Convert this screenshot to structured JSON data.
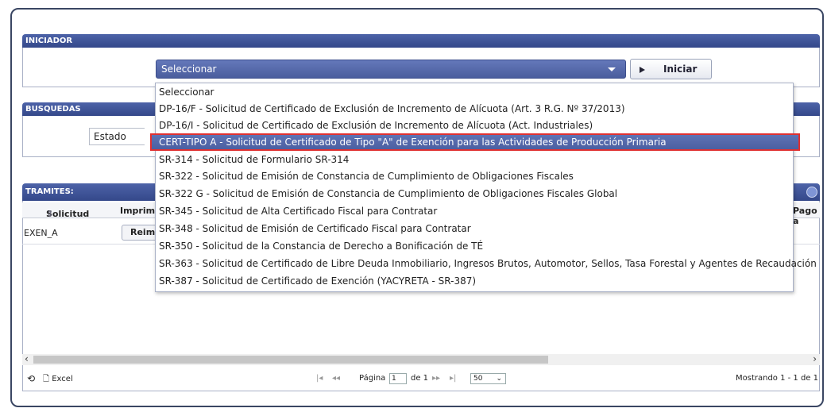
{
  "iniciador": {
    "title": "INICIADOR",
    "select_value": "Seleccionar",
    "start_button": "Iniciar"
  },
  "busquedas": {
    "title": "BUSQUEDAS",
    "estado_label": "Estado"
  },
  "tramites": {
    "title": "TRAMITES:",
    "columns": [
      "Solicitud",
      "Imprimi",
      "Pago a"
    ],
    "rows": [
      {
        "solicitud": "EXEN_A",
        "action": "Reim"
      }
    ]
  },
  "dropdown": {
    "options": [
      "Seleccionar",
      "DP-16/F - Solicitud de Certificado de Exclusión de Incremento de Alícuota (Art. 3 R.G. Nº 37/2013)",
      "DP-16/I - Solicitud de Certificado de Exclusión de Incremento de Alícuota (Act. Industriales)",
      "CERT-TIPO A - Solicitud de Certificado de Tipo \"A\" de Exención para las Actividades de Producción Primaria",
      "SR-314 - Solicitud de Formulario SR-314",
      "SR-322 - Solicitud de Emisión de Constancia de Cumplimiento de Obligaciones Fiscales",
      "SR-322 G - Solicitud de Emisión de Constancia de Cumplimiento de Obligaciones Fiscales Global",
      "SR-345 - Solicitud de Alta Certificado Fiscal para Contratar",
      "SR-348 - Solicitud de Emisión de Certificado Fiscal para Contratar",
      "SR-350 - Solicitud de la Constancia de Derecho a Bonificación de TÉ",
      "SR-363 - Solicitud de Certificado de Libre Deuda Inmobiliario, Ingresos Brutos, Automotor, Sellos, Tasa Forestal y Agentes de Recaudación",
      "SR-387 - Solicitud de Certificado de Exención (YACYRETA - SR-387)"
    ],
    "highlighted_index": 3
  },
  "footer": {
    "excel_label": "Excel",
    "page_label": "Página",
    "page_value": "1",
    "of_label": "de 1",
    "page_size": "50",
    "showing": "Mostrando 1 - 1 de 1"
  },
  "colors": {
    "header_bar": "#4d63a8",
    "select_bg": "#6478ba",
    "highlight_border": "#e03030"
  }
}
